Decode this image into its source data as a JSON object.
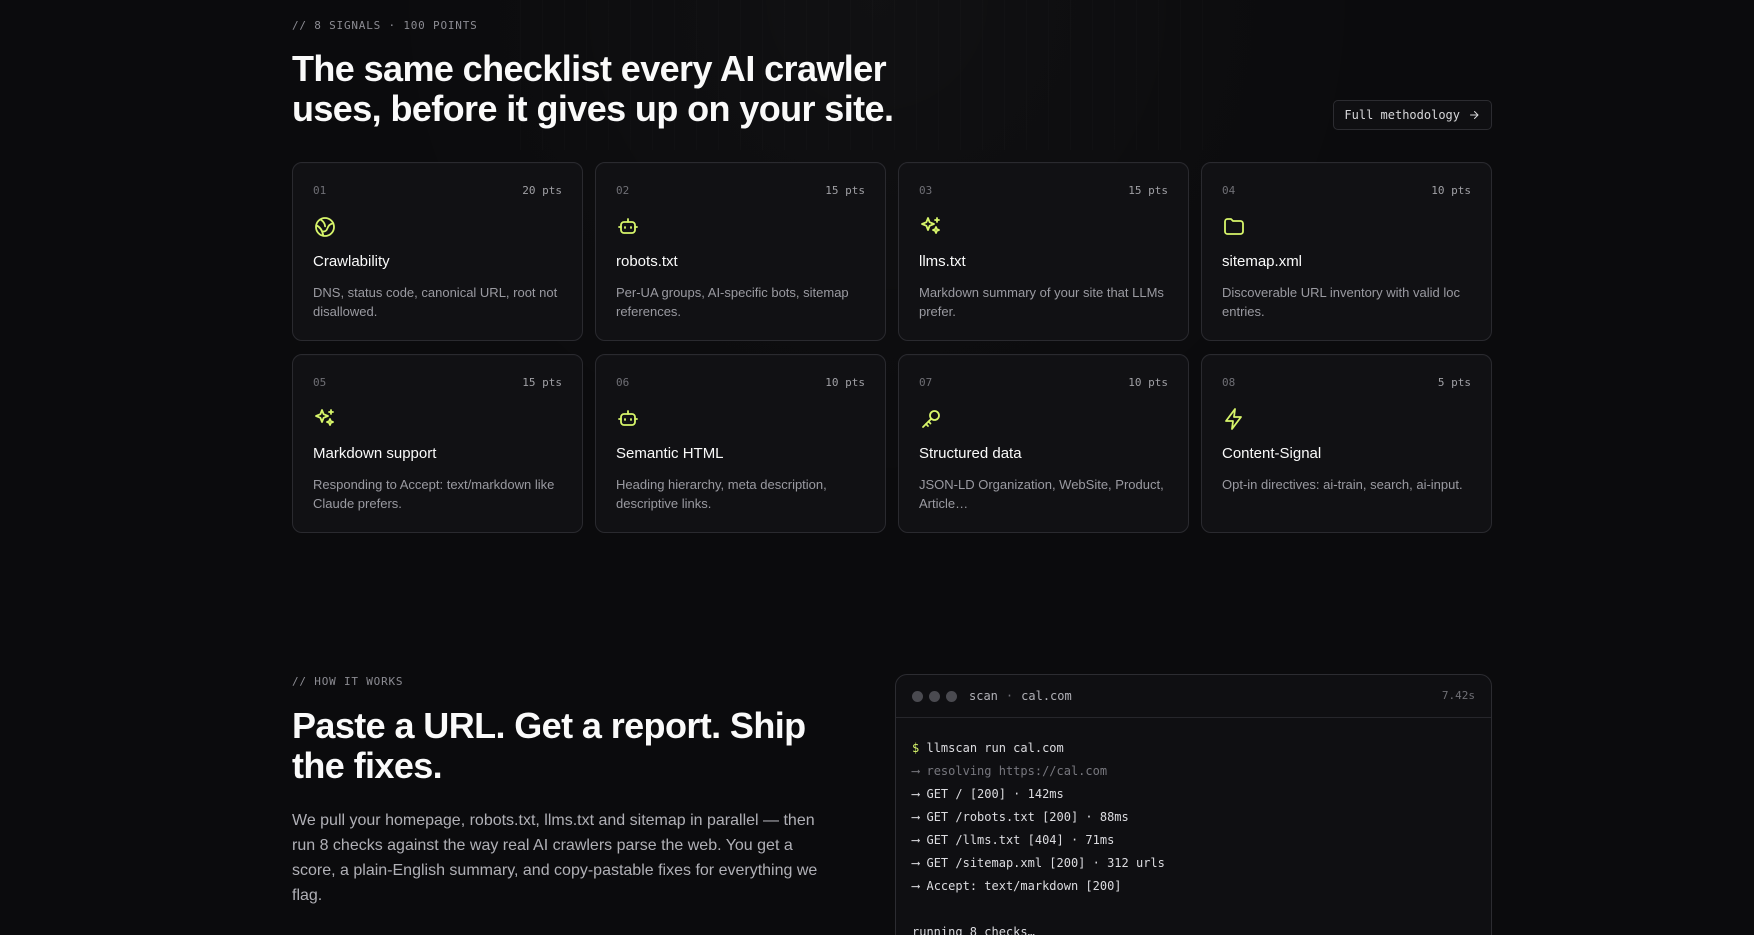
{
  "signals": {
    "eyebrow": "// 8 SIGNALS · 100 POINTS",
    "title": "The same checklist every AI crawler uses, before it gives up on your site.",
    "button_label": "Full methodology",
    "button_icon": "arrow-right-icon",
    "accent_color": "#d7f56a",
    "cards": [
      {
        "number": "01",
        "points": "20 pts",
        "icon": "globe-icon",
        "title": "Crawlability",
        "description": "DNS, status code, canonical URL, root not disallowed."
      },
      {
        "number": "02",
        "points": "15 pts",
        "icon": "bot-icon",
        "title": "robots.txt",
        "description": "Per-UA groups, AI-specific bots, sitemap references."
      },
      {
        "number": "03",
        "points": "15 pts",
        "icon": "sparkles-icon",
        "title": "llms.txt",
        "description": "Markdown summary of your site that LLMs prefer."
      },
      {
        "number": "04",
        "points": "10 pts",
        "icon": "folder-icon",
        "title": "sitemap.xml",
        "description": "Discoverable URL inventory with valid loc entries."
      },
      {
        "number": "05",
        "points": "15 pts",
        "icon": "sparkles-icon",
        "title": "Markdown support",
        "description": "Responding to Accept: text/markdown like Claude prefers."
      },
      {
        "number": "06",
        "points": "10 pts",
        "icon": "bot-icon",
        "title": "Semantic HTML",
        "description": "Heading hierarchy, meta description, descriptive links."
      },
      {
        "number": "07",
        "points": "10 pts",
        "icon": "key-icon",
        "title": "Structured data",
        "description": "JSON-LD Organization, WebSite, Product, Article…"
      },
      {
        "number": "08",
        "points": "5 pts",
        "icon": "zap-icon",
        "title": "Content-Signal",
        "description": "Opt-in directives: ai-train, search, ai-input."
      }
    ]
  },
  "how": {
    "eyebrow": "// HOW IT WORKS",
    "title": "Paste a URL. Get a report. Ship the fixes.",
    "body": "We pull your homepage, robots.txt, llms.txt and sitemap in parallel — then run 8 checks against the way real AI crawlers parse the web. You get a score, a plain-English summary, and copy-pastable fixes for everything we flag."
  },
  "terminal": {
    "label": "scan",
    "separator": "·",
    "domain": "cal.com",
    "duration": "7.42s",
    "prompt": "$",
    "command": "llmscan run cal.com",
    "arrow": "⟶",
    "lines": [
      "resolving https://cal.com",
      "GET / [200] · 142ms",
      "GET /robots.txt [200] · 88ms",
      "GET /llms.txt [404] · 71ms",
      "GET /sitemap.xml [200] · 312 urls",
      "Accept: text/markdown [200]"
    ],
    "status": "running 8 checks…"
  }
}
